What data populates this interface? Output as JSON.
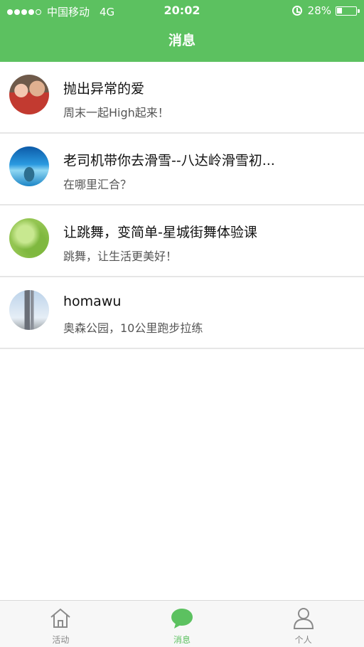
{
  "status_bar": {
    "carrier": "中国移动",
    "network": "4G",
    "time": "20:02",
    "battery": "28%",
    "battery_level": 0.28,
    "signal_bars_filled": 4,
    "signal_bars_total": 5
  },
  "nav": {
    "title": "消息"
  },
  "messages": [
    {
      "title": "抛出异常的爱",
      "subtitle": "周末一起High起来！"
    },
    {
      "title": "老司机带你去滑雪--八达岭滑雪初...",
      "subtitle": "在哪里汇合？"
    },
    {
      "title": "让跳舞，变简单-星城街舞体验课",
      "subtitle": "跳舞，让生活更美好！"
    },
    {
      "title": "homawu",
      "subtitle": "奥森公园，10公里跑步拉练"
    }
  ],
  "tabs": [
    {
      "label": "活动",
      "icon": "home-icon",
      "active": false
    },
    {
      "label": "消息",
      "icon": "chat-bubble-icon",
      "active": true
    },
    {
      "label": "个人",
      "icon": "person-icon",
      "active": false
    }
  ],
  "colors": {
    "accent": "#5cc160",
    "inactive": "#888888"
  }
}
